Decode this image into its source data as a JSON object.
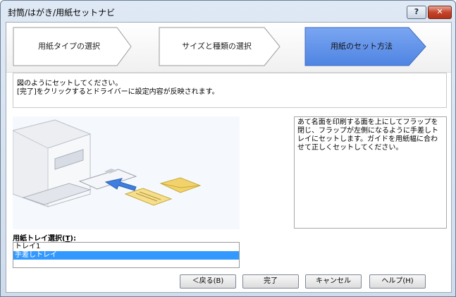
{
  "window": {
    "title": "封筒/はがき/用紙セットナビ",
    "help_button": "?",
    "close_button": "✕"
  },
  "steps": [
    {
      "label": "用紙タイプの選択",
      "active": false
    },
    {
      "label": "サイズと種類の選択",
      "active": false
    },
    {
      "label": "用紙のセット方法",
      "active": true
    }
  ],
  "message": {
    "line1": "図のようにセットしてください。",
    "line2": "[完了]をクリックするとドライバーに設定内容が反映されます。"
  },
  "description": "あて名面を印刷する面を上にしてフラップを閉じ、フラップが左側になるように手差しトレイにセットします。ガイドを用紙幅に合わせて正しくセットしてください。",
  "tray": {
    "label": "用紙トレイ選択(T):",
    "label_prefix": "用紙トレイ選択(",
    "label_key": "T",
    "label_suffix": "):",
    "items": [
      {
        "label": "トレイ1",
        "selected": false
      },
      {
        "label": "手差しトレイ",
        "selected": true
      }
    ]
  },
  "buttons": {
    "back": "＜戻る(B)",
    "finish": "完了",
    "cancel": "キャンセル",
    "help": "ヘルプ(H)"
  },
  "colors": {
    "active_step": "#5b8fe8",
    "selection": "#3399ff",
    "envelope": "#f2d36b"
  }
}
